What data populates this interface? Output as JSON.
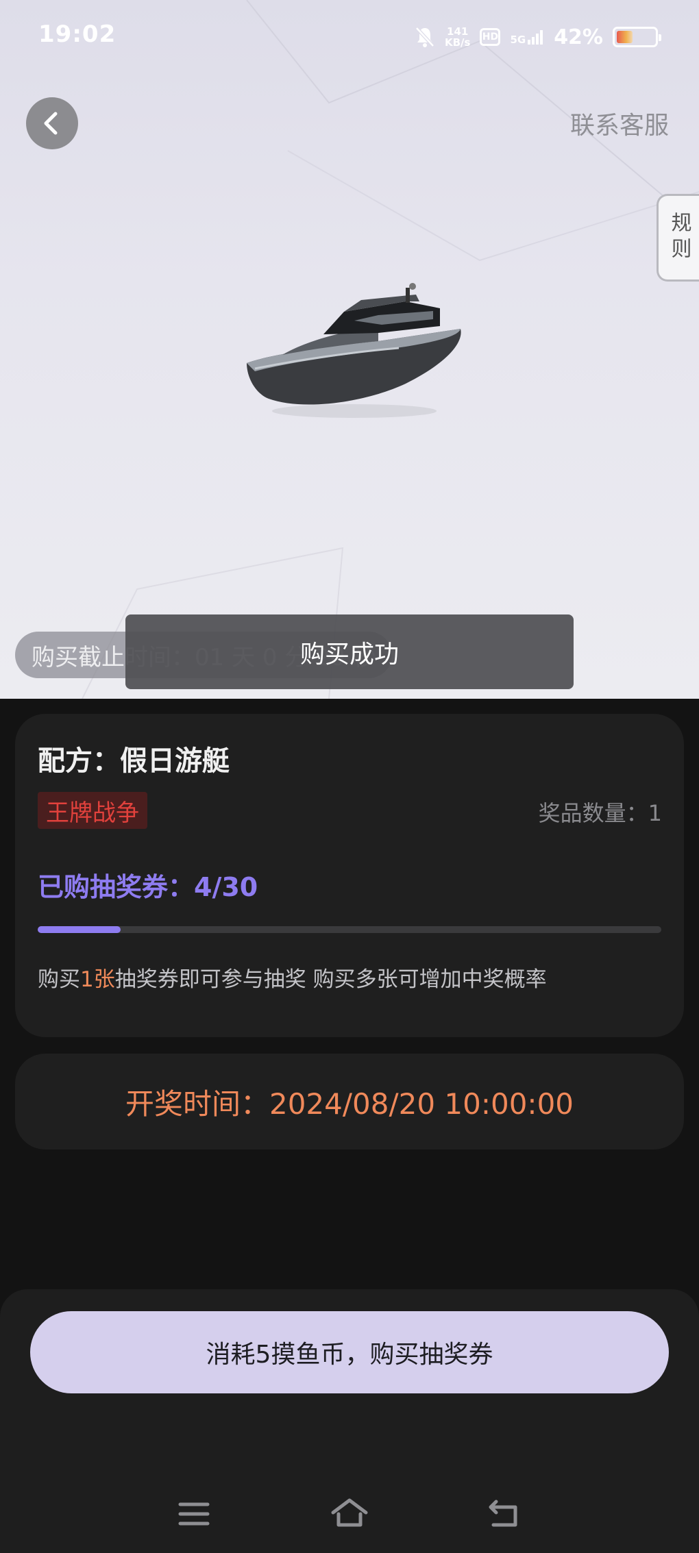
{
  "status_bar": {
    "time": "19:02",
    "net_speed_value": "141",
    "net_speed_unit": "KB/s",
    "hd": "HD",
    "signal": "5G",
    "battery_percent": "42%",
    "battery_level": 0.42
  },
  "header": {
    "contact_label": "联系客服",
    "rules_label": "规则"
  },
  "hero": {
    "countdown_text": "购买截止时间：01 天 0  分 20 秒",
    "toast_text": "购买成功"
  },
  "item": {
    "title": "配方：假日游艇",
    "tag": "王牌战争",
    "prize_qty": "奖品数量：1",
    "purchased": "已购抽奖券：4/30",
    "progress": 0.133,
    "hint_before": "购买",
    "hint_highlight": "1张",
    "hint_after": "抽奖券即可参与抽奖 购买多张可增加中奖概率"
  },
  "draw": {
    "time_text": "开奖时间：2024/08/20 10:00:00"
  },
  "actions": {
    "buy_label": "消耗5摸鱼币，购买抽奖券"
  },
  "colors": {
    "accent": "#8e7cf0",
    "orange": "#f0895a",
    "tag_red": "#e2413c",
    "button_bg": "#d5cfed"
  }
}
